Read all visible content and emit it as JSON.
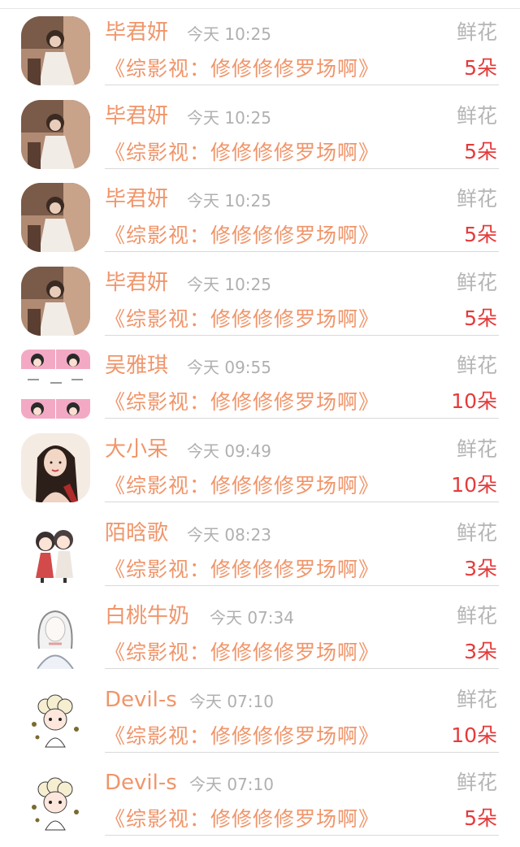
{
  "gift_list": {
    "items": [
      {
        "name": "毕君妍",
        "time": "今天 10:25",
        "gift": "鲜花",
        "title": "《综影视：修修修修罗场啊》",
        "count": "5朵",
        "avatar": "photo-girl-white-dress-avatar"
      },
      {
        "name": "毕君妍",
        "time": "今天 10:25",
        "gift": "鲜花",
        "title": "《综影视：修修修修罗场啊》",
        "count": "5朵",
        "avatar": "photo-girl-white-dress-avatar"
      },
      {
        "name": "毕君妍",
        "time": "今天 10:25",
        "gift": "鲜花",
        "title": "《综影视：修修修修罗场啊》",
        "count": "5朵",
        "avatar": "photo-girl-white-dress-avatar"
      },
      {
        "name": "毕君妍",
        "time": "今天 10:25",
        "gift": "鲜花",
        "title": "《综影视：修修修修罗场啊》",
        "count": "5朵",
        "avatar": "photo-girl-white-dress-avatar"
      },
      {
        "name": "吴雅琪",
        "time": "今天 09:55",
        "gift": "鲜花",
        "title": "《综影视：修修修修罗场啊》",
        "count": "10朵",
        "avatar": "cartoon-grid-avatar"
      },
      {
        "name": "大小呆",
        "time": "今天 09:49",
        "gift": "鲜花",
        "title": "《综影视：修修修修罗场啊》",
        "count": "10朵",
        "avatar": "illustrated-woman-avatar"
      },
      {
        "name": "陌晗歌",
        "time": "今天 08:23",
        "gift": "鲜花",
        "title": "《综影视：修修修修罗场啊》",
        "count": "3朵",
        "avatar": "chibi-couple-avatar"
      },
      {
        "name": "白桃牛奶",
        "time": "今天 07:34",
        "gift": "鲜花",
        "title": "《综影视：修修修修罗场啊》",
        "count": "3朵",
        "avatar": "sketch-girl-avatar"
      },
      {
        "name": "Devil-s",
        "time": "今天 07:10",
        "gift": "鲜花",
        "title": "《综影视：修修修修罗场啊》",
        "count": "10朵",
        "avatar": "cartoon-sheep-girl-avatar"
      },
      {
        "name": "Devil-s",
        "time": "今天 07:10",
        "gift": "鲜花",
        "title": "《综影视：修修修修罗场啊》",
        "count": "5朵",
        "avatar": "cartoon-sheep-girl-avatar"
      }
    ]
  },
  "colors": {
    "accent": "#f0956a",
    "count": "#e53b3b",
    "muted": "#b0b0b0"
  }
}
